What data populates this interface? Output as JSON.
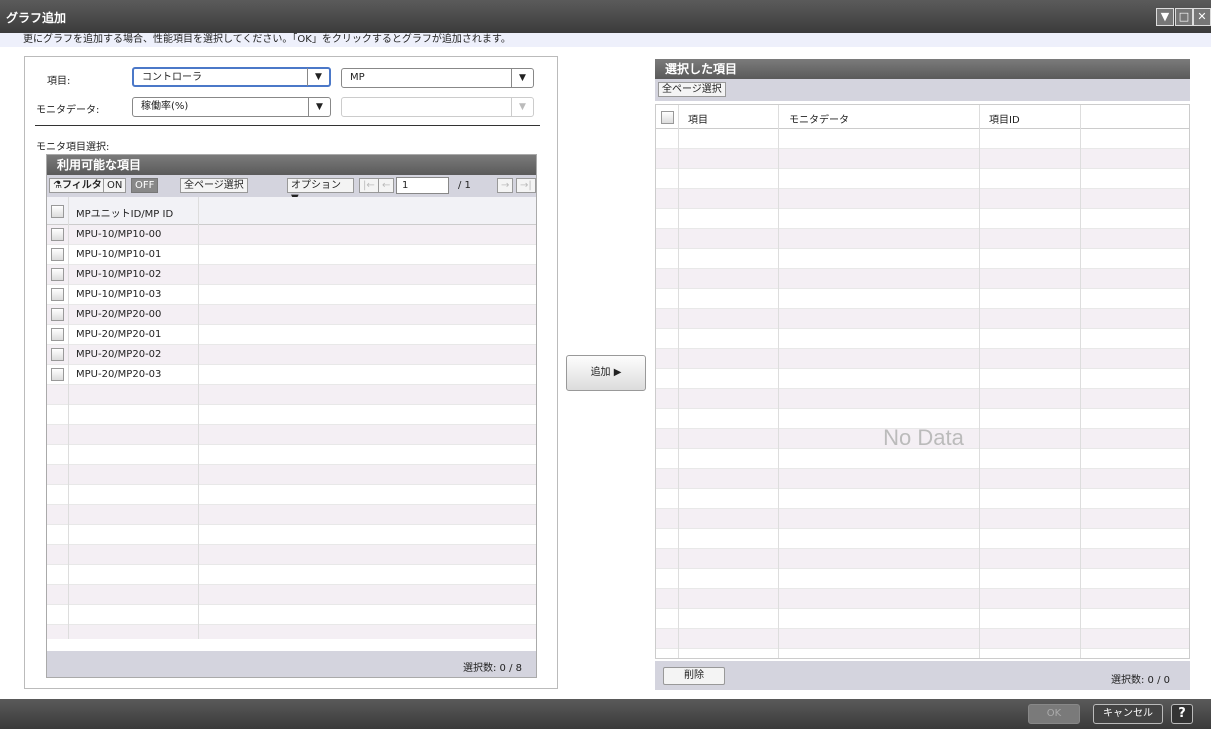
{
  "window": {
    "title": "グラフ追加",
    "description": "更にグラフを追加する場合、性能項目を選択してください。「OK」をクリックするとグラフが追加されます。"
  },
  "form": {
    "item_label": "項目:",
    "item_value": "コントローラ",
    "item2_value": "MP",
    "monitor_label": "モニタデータ:",
    "monitor_value": "稼働率(%)",
    "monitor2_value": "",
    "monitor_select_label": "モニタ項目選択:"
  },
  "available": {
    "title": "利用可能な項目",
    "filter_label": "フィルタ",
    "on_label": "ON",
    "off_label": "OFF",
    "select_all_label": "全ページ選択",
    "options_label": "オプション",
    "page_value": "1",
    "page_total": "/ 1",
    "column_header": "MPユニットID/MP ID",
    "rows": [
      "MPU-10/MP10-00",
      "MPU-10/MP10-01",
      "MPU-10/MP10-02",
      "MPU-10/MP10-03",
      "MPU-20/MP20-00",
      "MPU-20/MP20-01",
      "MPU-20/MP20-02",
      "MPU-20/MP20-03"
    ],
    "selected_count": "選択数: 0 / 8"
  },
  "add_button": "追加 ▶",
  "selected": {
    "title": "選択した項目",
    "select_all_label": "全ページ選択",
    "columns": [
      "項目",
      "モニタデータ",
      "項目ID"
    ],
    "no_data": "No Data",
    "delete_label": "削除",
    "selected_count": "選択数: 0 / 0"
  },
  "buttons": {
    "ok": "OK",
    "cancel": "キャンセル",
    "help": "?"
  },
  "colors": {
    "accent": "#4b78c8",
    "header_dark": "#5a5a5a"
  }
}
